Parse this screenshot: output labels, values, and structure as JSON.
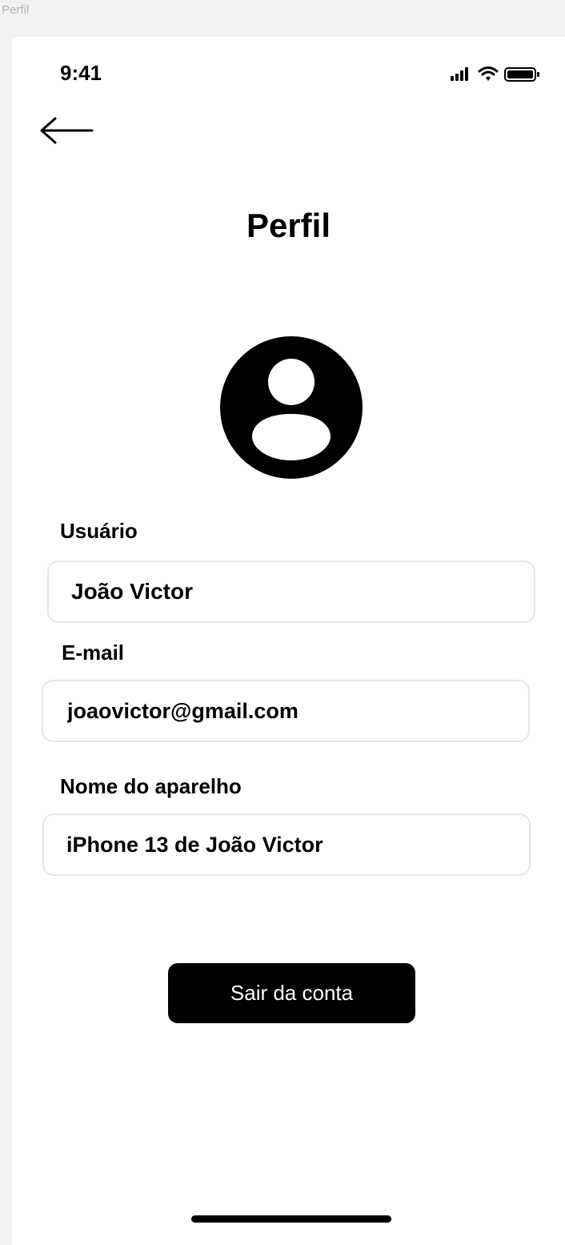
{
  "frame": {
    "label": "Perfil"
  },
  "status_bar": {
    "time": "9:41",
    "icons": [
      "signal-icon",
      "wifi-icon",
      "battery-icon"
    ]
  },
  "header": {
    "back_icon": "arrow-left-icon",
    "title": "Perfil"
  },
  "avatar": {
    "icon": "user-avatar-icon"
  },
  "form": {
    "username": {
      "label": "Usuário",
      "value": "João Victor"
    },
    "email": {
      "label": "E-mail",
      "value": "joaovictor@gmail.com"
    },
    "device_name": {
      "label": "Nome do aparelho",
      "value": "iPhone 13 de João Victor"
    }
  },
  "actions": {
    "logout_label": "Sair da conta"
  },
  "colors": {
    "primary": "#000000",
    "background": "#ffffff",
    "field_border": "#e6e6e6",
    "canvas": "#f2f2f2"
  }
}
